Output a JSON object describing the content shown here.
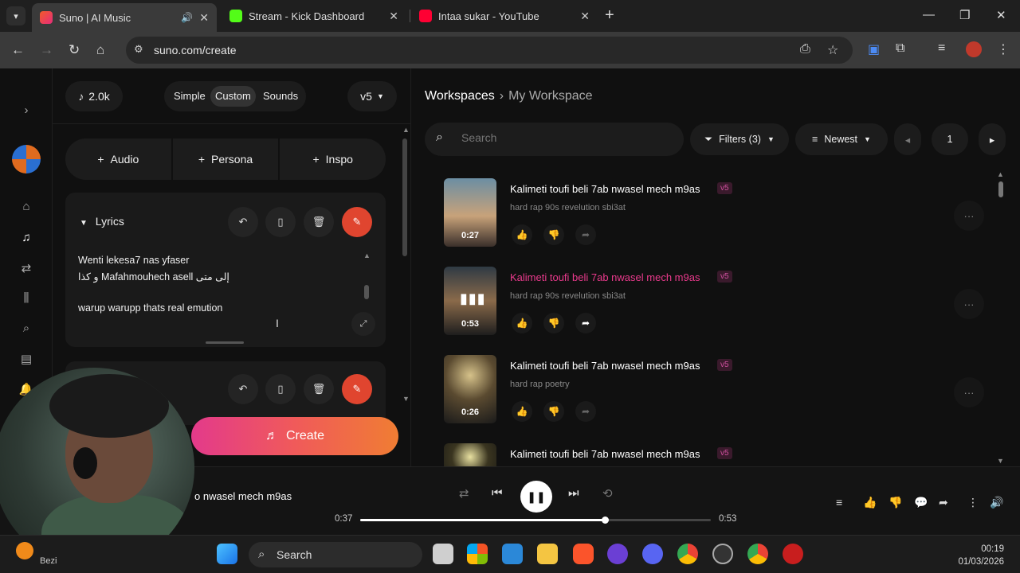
{
  "browser": {
    "tabs": [
      {
        "title": "Suno | AI Music",
        "active": true
      },
      {
        "title": "Stream - Kick Dashboard",
        "active": false
      },
      {
        "title": "Intaa sukar - YouTube",
        "active": false
      }
    ],
    "new_tab": "+",
    "url": "suno.com/create"
  },
  "left": {
    "credits": "2.0k",
    "modes": [
      "Simple",
      "Custom",
      "Sounds"
    ],
    "active_mode": "Custom",
    "version": "v5",
    "add_buttons": [
      "Audio",
      "Persona",
      "Inspo"
    ],
    "lyrics_header": "Lyrics",
    "lyrics_lines": [
      "Wenti lekesa7 nas yfaser",
      "و كذا Mafahmouhech asell إلى متى",
      "",
      "warup warupp thats real emution"
    ],
    "create_label": "Create"
  },
  "workspace": {
    "crumb_root": "Workspaces",
    "crumb_current": "My Workspace",
    "search_placeholder": "Search",
    "filters_label": "Filters (3)",
    "sort_label": "Newest",
    "page": "1",
    "songs": [
      {
        "title": "Kalimeti toufi beli 7ab nwasel mech m9as",
        "badge": "v5",
        "tags": "hard rap 90s revelution sbi3at",
        "duration": "0:27",
        "playing": false
      },
      {
        "title": "Kalimeti toufi beli 7ab nwasel mech m9as",
        "badge": "v5",
        "tags": "hard rap 90s revelution sbi3at",
        "duration": "0:53",
        "playing": true
      },
      {
        "title": "Kalimeti toufi beli 7ab nwasel mech m9as",
        "badge": "v5",
        "tags": "hard rap poetry",
        "duration": "0:26",
        "playing": false
      },
      {
        "title": "Kalimeti toufi beli 7ab nwasel mech m9as",
        "badge": "v5",
        "tags": "",
        "duration": "",
        "playing": false
      }
    ]
  },
  "player": {
    "now_playing": "o nwasel mech m9as",
    "elapsed": "0:37",
    "total": "0:53",
    "progress": 0.698
  },
  "taskbar": {
    "search_label": "Search",
    "weather_text": "Bezi",
    "time": "00:19",
    "date": "01/03/2026"
  },
  "colors": {
    "accent_pink": "#e93a8c",
    "hot_button": "#e0452f"
  }
}
